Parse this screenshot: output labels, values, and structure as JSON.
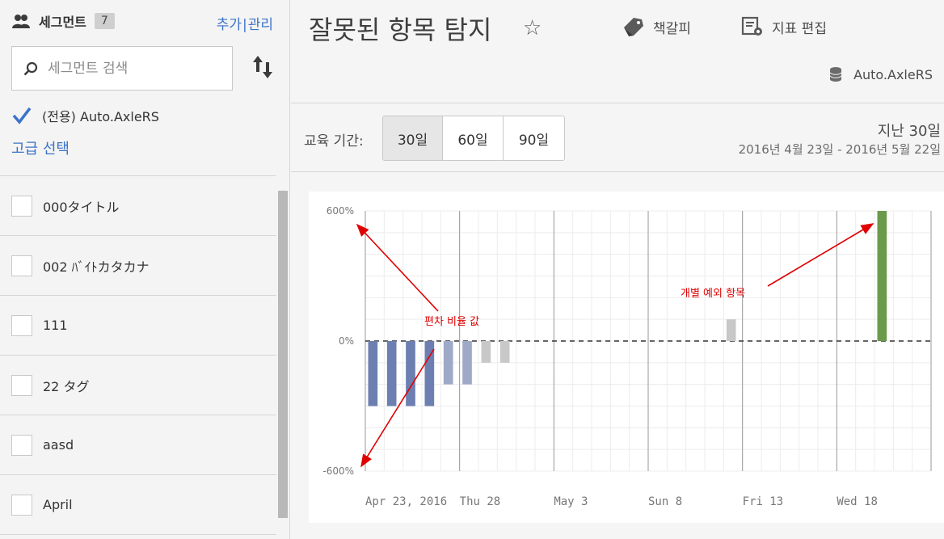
{
  "sidebar": {
    "title": "세그먼트",
    "count": "7",
    "link_add": "추가",
    "link_sep": "|",
    "link_manage": "관리",
    "search_placeholder": "세그먼트 검색",
    "selected_rs": "(전용) Auto.AxleRS",
    "advanced": "고급 선택",
    "segments": [
      "000タイトル",
      "002 ﾊﾞｲﾄカタカナ",
      "111",
      "22 タグ",
      "aasd",
      "April"
    ]
  },
  "header": {
    "title": "잘못된 항목 탐지",
    "bookmark": "책갈피",
    "edit_metrics": "지표 편집",
    "report_suite": "Auto.AxleRS"
  },
  "training": {
    "label": "교육 기간:",
    "options": [
      "30일",
      "60일",
      "90일"
    ],
    "selected": "30일",
    "range_label": "지난 30일",
    "range_dates": "2016년 4월 23일 - 2016년 5월 22일"
  },
  "colors": {
    "accent": "#3a73c8",
    "bar_dark": "#6c7fb0",
    "bar_mid": "#9ea9c8",
    "bar_light": "#c8c8c8",
    "bar_anomaly": "#6a9a4a",
    "annotation": "#e00000"
  },
  "icons": {
    "segments": "people-icon",
    "search": "search-icon",
    "sort": "sort-icon",
    "bookmark": "bookmark-icon",
    "edit_metrics": "edit-metrics-icon",
    "report_suite": "database-icon",
    "favorite": "star-icon"
  },
  "chart_data": {
    "type": "bar",
    "ylim": [
      -600,
      600
    ],
    "yticks": [
      "600%",
      "0%",
      "-600%"
    ],
    "xtick_labels": [
      "Apr 23, 2016",
      "Thu 28",
      "May 3",
      "Sun 8",
      "Fri 13",
      "Wed 18"
    ],
    "days": 30,
    "series": [
      {
        "day": 1,
        "value": -300,
        "tone": "dark"
      },
      {
        "day": 2,
        "value": -300,
        "tone": "dark"
      },
      {
        "day": 3,
        "value": -300,
        "tone": "dark"
      },
      {
        "day": 4,
        "value": -300,
        "tone": "dark"
      },
      {
        "day": 5,
        "value": -200,
        "tone": "mid"
      },
      {
        "day": 6,
        "value": -200,
        "tone": "mid"
      },
      {
        "day": 7,
        "value": -100,
        "tone": "light"
      },
      {
        "day": 8,
        "value": -100,
        "tone": "light"
      },
      {
        "day": 20,
        "value": 100,
        "tone": "light"
      },
      {
        "day": 28,
        "value": 600,
        "tone": "anomaly"
      }
    ],
    "annotations": {
      "deviation": "편차 비율 값",
      "anomaly": "개별 예외 항목"
    }
  }
}
